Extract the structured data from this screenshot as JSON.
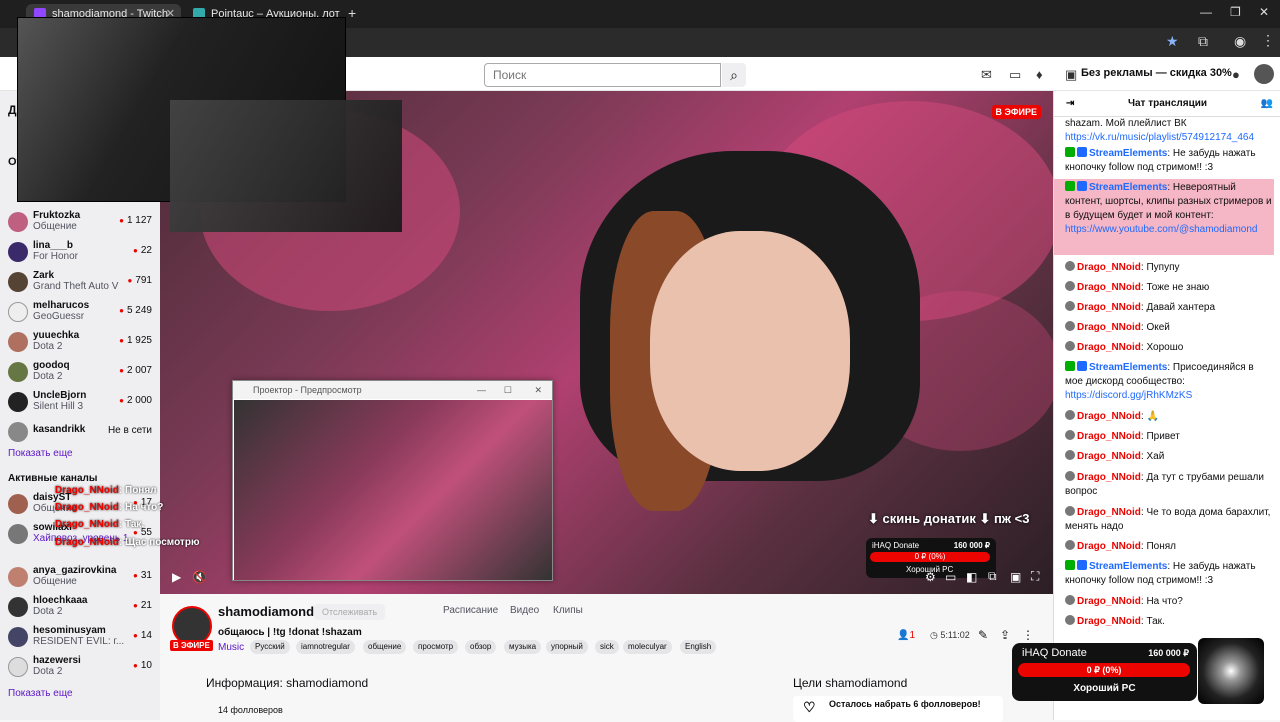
{
  "browser": {
    "tabs": [
      {
        "title": "shamodiamond - Twitch",
        "active": true
      },
      {
        "title": "Pointauc – Аукционы, лотереи",
        "active": false
      }
    ],
    "new_tab": "+"
  },
  "twitch_top": {
    "search_placeholder": "Поиск",
    "promo": "Без рекламы — скидка 30%"
  },
  "sidebar": {
    "sections": [
      {
        "title": "Д"
      },
      {
        "title": "От"
      }
    ],
    "followed": [
      {
        "name": "Fruktozka",
        "game": "Общение",
        "viewers": "1 127",
        "color": "#c06080"
      },
      {
        "name": "lina___b",
        "game": "For Honor",
        "viewers": "22",
        "color": "#3a2a6a"
      },
      {
        "name": "Zark",
        "game": "Grand Theft Auto V",
        "viewers": "791",
        "color": "#554433"
      },
      {
        "name": "melharucos",
        "game": "GeoGuessr",
        "viewers": "5 249",
        "color": "#eeeeee"
      },
      {
        "name": "yuuechka",
        "game": "Dota 2",
        "viewers": "1 925",
        "color": "#b07060"
      },
      {
        "name": "goodoq",
        "game": "Dota 2",
        "viewers": "2 007",
        "color": "#667744"
      },
      {
        "name": "UncleBjorn",
        "game": "Silent Hill 3",
        "viewers": "2 000",
        "color": "#222222"
      },
      {
        "name": "kasandrikk",
        "game": "",
        "viewers": "",
        "offline": "Не в сети",
        "color": "#888888"
      }
    ],
    "show_more_1": "Показать еще",
    "active_title": "Активные каналы",
    "active": [
      {
        "name": "daisyST",
        "game": "Общение",
        "viewers": "17",
        "color": "#a06050"
      },
      {
        "name": "sowiiaxi",
        "game": "Хайповоз, уровень 1",
        "viewers": "55",
        "color": "#777777"
      },
      {
        "name": "anya_gazirovkina",
        "game": "Общение",
        "viewers": "31",
        "color": "#c08070"
      },
      {
        "name": "hloechkaaa",
        "game": "Dota 2",
        "viewers": "21",
        "color": "#333333"
      },
      {
        "name": "hesominusyam",
        "game": "RESIDENT EVIL: г...",
        "viewers": "14",
        "color": "#444466"
      },
      {
        "name": "hazewersi",
        "game": "Dota 2",
        "viewers": "10",
        "color": "#dddddd"
      }
    ],
    "show_more_2": "Показать еще"
  },
  "video": {
    "live": "В ЭФИРЕ",
    "overlay_text": "⬇ скинь донатик ⬇ пж <3",
    "donate_title": "iHAQ Donate",
    "donate_amount": "160 000 ₽",
    "donate_bar": "0 ₽ (0%)",
    "donate_sub": "Хороший PC"
  },
  "projector": {
    "title": "Проектор - Предпросмотр"
  },
  "overlay_chat": [
    {
      "nick": "Drago_NNoid",
      "text": "Понял"
    },
    {
      "nick": "Drago_NNoid",
      "text": "На что?"
    },
    {
      "nick": "Drago_NNoid",
      "text": "Так."
    },
    {
      "nick": "Drago_NNoid",
      "text": "Щас посмотрю"
    }
  ],
  "stream": {
    "name": "shamodiamond",
    "follow": "Отслеживать",
    "nav": [
      "Расписание",
      "Видео",
      "Клипы"
    ],
    "title": "общаюсь | !tg !donat !shazam",
    "category": "Music",
    "live": "В ЭФИРЕ",
    "tags": [
      "Русский",
      "iamnotregular",
      "общение",
      "просмотр",
      "обзор",
      "музыка",
      "упорный",
      "sick",
      "moleculyar",
      "English"
    ],
    "viewers": "1",
    "uptime": "5:11:02",
    "info_head": "Информация: shamodiamond",
    "followers": "14 фолловеров",
    "goals_head": "Цели shamodiamond",
    "goal": "Осталось набрать 6 фолловеров!"
  },
  "chat": {
    "header": "Чат трансляции",
    "messages": [
      {
        "user": "",
        "text": "shazam. Мой плейлист ВК",
        "link": "https://vk.ru/music/playlist/574912174_464"
      },
      {
        "user": "StreamElements",
        "text": ": Не забудь нажать кнопочку follow под стримом!! :3"
      },
      {
        "user": "StreamElements",
        "text": ": Невероятный контент, шортсы, клипы разных стримеров и в будущем будет и мой контент:",
        "link": "https://www.youtube.com/@shamodiamond"
      },
      {
        "user": "Drago_NNoid",
        "text": ": Пупупу"
      },
      {
        "user": "Drago_NNoid",
        "text": ": Тоже не знаю"
      },
      {
        "user": "Drago_NNoid",
        "text": ": Давай хантера"
      },
      {
        "user": "Drago_NNoid",
        "text": ": Окей"
      },
      {
        "user": "Drago_NNoid",
        "text": ": Хорошо"
      },
      {
        "user": "StreamElements",
        "text": ": Присоединяйся в мое дискорд сообщество:",
        "link": "https://discord.gg/jRhKMzKS"
      },
      {
        "user": "Drago_NNoid",
        "text": ":"
      },
      {
        "user": "Drago_NNoid",
        "text": ": Привет"
      },
      {
        "user": "Drago_NNoid",
        "text": ": Хай"
      },
      {
        "user": "Drago_NNoid",
        "text": ": Да тут с трубами решали вопрос"
      },
      {
        "user": "Drago_NNoid",
        "text": ": Че то вода дома барахлит, менять надо"
      },
      {
        "user": "Drago_NNoid",
        "text": ": Понял"
      },
      {
        "user": "StreamElements",
        "text": ": Не забудь нажать кнопочку follow под стримом!! :3"
      },
      {
        "user": "Drago_NNoid",
        "text": ": На что?"
      },
      {
        "user": "Drago_NNoid",
        "text": ": Так."
      }
    ]
  },
  "donate2": {
    "title": "iHAQ Donate",
    "amount": "160 000 ₽",
    "bar": "0 ₽ (0%)",
    "sub": "Хороший PC"
  }
}
